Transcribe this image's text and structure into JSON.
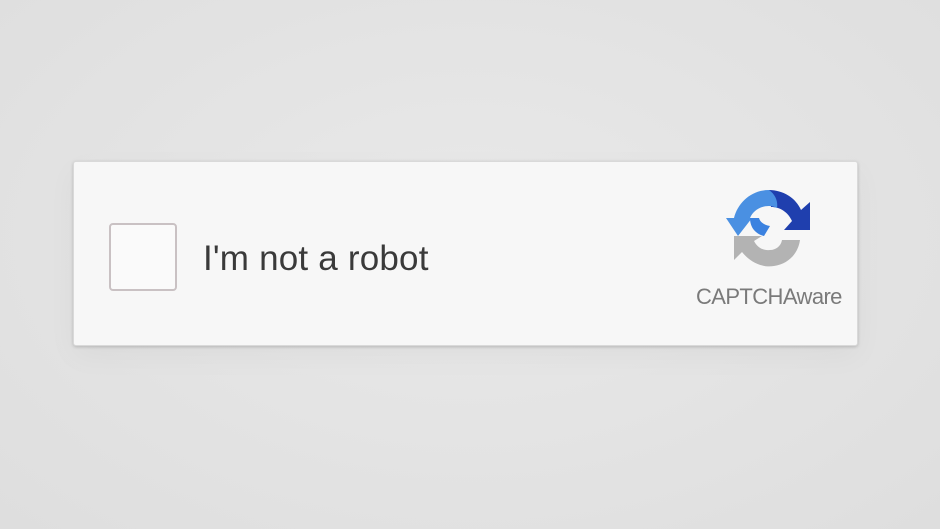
{
  "captcha": {
    "label": "I'm not a robot",
    "brand": "CAPTCHAware",
    "checked": false,
    "checkbox_icon": "unchecked-square-icon",
    "logo_icon": "captcha-recycle-arrows-icon"
  },
  "colors": {
    "background": "#e3e3e3",
    "card": "#f7f7f7",
    "text": "#3a3a3a",
    "logo_blue_light": "#4a90e2",
    "logo_blue_dark": "#1f3fae",
    "logo_gray": "#b3b3b3",
    "brand_text": "#7a7a7a"
  }
}
